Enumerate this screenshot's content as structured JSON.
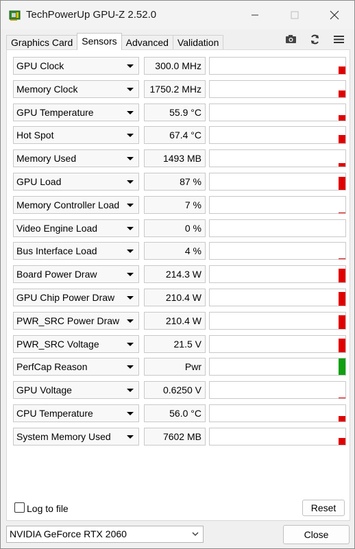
{
  "window": {
    "title": "TechPowerUp GPU-Z 2.52.0"
  },
  "tabs": [
    {
      "label": "Graphics Card",
      "active": false
    },
    {
      "label": "Sensors",
      "active": true
    },
    {
      "label": "Advanced",
      "active": false
    },
    {
      "label": "Validation",
      "active": false
    }
  ],
  "toolbar": {
    "icons": [
      "camera-icon",
      "refresh-icon",
      "menu-icon"
    ]
  },
  "sensors": [
    {
      "name": "GPU Clock",
      "value": "300.0 MHz",
      "level": 0.45,
      "color": "#e00000"
    },
    {
      "name": "Memory Clock",
      "value": "1750.2 MHz",
      "level": 0.4,
      "color": "#e00000"
    },
    {
      "name": "GPU Temperature",
      "value": "55.9 °C",
      "level": 0.35,
      "color": "#e00000"
    },
    {
      "name": "Hot Spot",
      "value": "67.4 °C",
      "level": 0.5,
      "color": "#e00000"
    },
    {
      "name": "Memory Used",
      "value": "1493 MB",
      "level": 0.2,
      "color": "#e00000"
    },
    {
      "name": "GPU Load",
      "value": "87 %",
      "level": 0.8,
      "color": "#e00000"
    },
    {
      "name": "Memory Controller Load",
      "value": "7 %",
      "level": 0.06,
      "color": "#e00000"
    },
    {
      "name": "Video Engine Load",
      "value": "0 %",
      "level": 0.0,
      "color": "#e00000"
    },
    {
      "name": "Bus Interface Load",
      "value": "4 %",
      "level": 0.04,
      "color": "#e00000"
    },
    {
      "name": "Board Power Draw",
      "value": "214.3 W",
      "level": 0.85,
      "color": "#e00000"
    },
    {
      "name": "GPU Chip Power Draw",
      "value": "210.4 W",
      "level": 0.85,
      "color": "#e00000"
    },
    {
      "name": "PWR_SRC Power Draw",
      "value": "210.4 W",
      "level": 0.85,
      "color": "#e00000"
    },
    {
      "name": "PWR_SRC Voltage",
      "value": "21.5 V",
      "level": 0.85,
      "color": "#e00000"
    },
    {
      "name": "PerfCap Reason",
      "value": "Pwr",
      "level": 1.0,
      "color": "#10a010"
    },
    {
      "name": "GPU Voltage",
      "value": "0.6250 V",
      "level": 0.06,
      "color": "#e00000"
    },
    {
      "name": "CPU Temperature",
      "value": "56.0 °C",
      "level": 0.35,
      "color": "#e00000"
    },
    {
      "name": "System Memory Used",
      "value": "7602 MB",
      "level": 0.4,
      "color": "#e00000"
    }
  ],
  "footer": {
    "log_label": "Log to file",
    "log_checked": false,
    "reset_label": "Reset",
    "device": "NVIDIA GeForce RTX 2060",
    "close_label": "Close"
  }
}
